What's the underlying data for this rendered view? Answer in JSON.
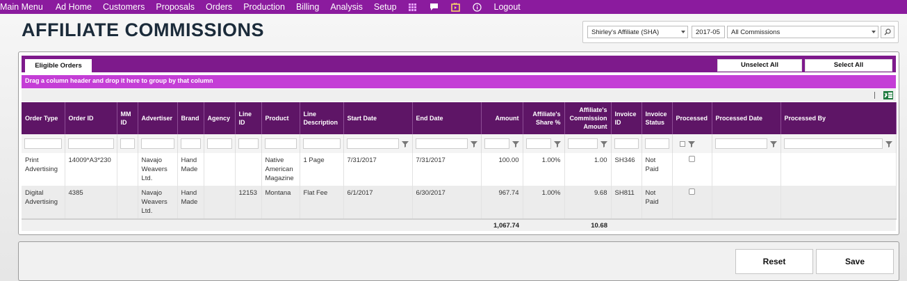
{
  "nav": {
    "items": [
      "Main Menu",
      "Ad Home",
      "Customers",
      "Proposals",
      "Orders",
      "Production",
      "Billing",
      "Analysis",
      "Setup"
    ],
    "icons": [
      "grid-icon",
      "chat-icon",
      "video-icon",
      "info-icon"
    ],
    "logout": "Logout"
  },
  "page": {
    "title": "AFFILIATE COMMISSIONS"
  },
  "filters": {
    "affiliate": "Shirley's Affiliate (SHA)",
    "period": "2017-05",
    "commission_type": "All Commissions"
  },
  "tabs": [
    {
      "label": "Eligible Orders"
    }
  ],
  "buttons": {
    "unselect_all": "Unselect All",
    "select_all": "Select All",
    "reset": "Reset",
    "save": "Save"
  },
  "grid": {
    "group_hint": "Drag a column header and drop it here to group by that column",
    "columns": [
      "Order Type",
      "Order ID",
      "MM ID",
      "Advertiser",
      "Brand",
      "Agency",
      "Line ID",
      "Product",
      "Line Description",
      "Start Date",
      "End Date",
      "Amount",
      "Affiliate's Share %",
      "Affiliate's Commission Amount",
      "Invoice ID",
      "Invoice Status",
      "Processed",
      "Processed Date",
      "Processed By"
    ],
    "rows": [
      {
        "order_type": "Print Advertising",
        "order_id": "14009*A3*230",
        "mm_id": "",
        "advertiser": "Navajo Weavers Ltd.",
        "brand": "Hand Made",
        "agency": "",
        "line_id": "",
        "product": "Native American Magazine",
        "line_description": "1 Page",
        "start_date": "7/31/2017",
        "end_date": "7/31/2017",
        "amount": "100.00",
        "share": "1.00%",
        "commission": "1.00",
        "invoice_id": "SH346",
        "invoice_status": "Not Paid",
        "processed_date": "",
        "processed_by": ""
      },
      {
        "order_type": "Digital Advertising",
        "order_id": "4385",
        "mm_id": "",
        "advertiser": "Navajo Weavers Ltd.",
        "brand": "Hand Made",
        "agency": "",
        "line_id": "12153",
        "product": "Montana",
        "line_description": "Flat Fee",
        "start_date": "6/1/2017",
        "end_date": "6/30/2017",
        "amount": "967.74",
        "share": "1.00%",
        "commission": "9.68",
        "invoice_id": "SH811",
        "invoice_status": "Not Paid",
        "processed_date": "",
        "processed_by": ""
      }
    ],
    "totals": {
      "amount": "1,067.74",
      "commission": "10.68"
    }
  },
  "colors": {
    "nav": "#8b1b9e",
    "header": "#5e1566",
    "group_bar": "#c43ed6",
    "link": "#9b2bb0"
  }
}
